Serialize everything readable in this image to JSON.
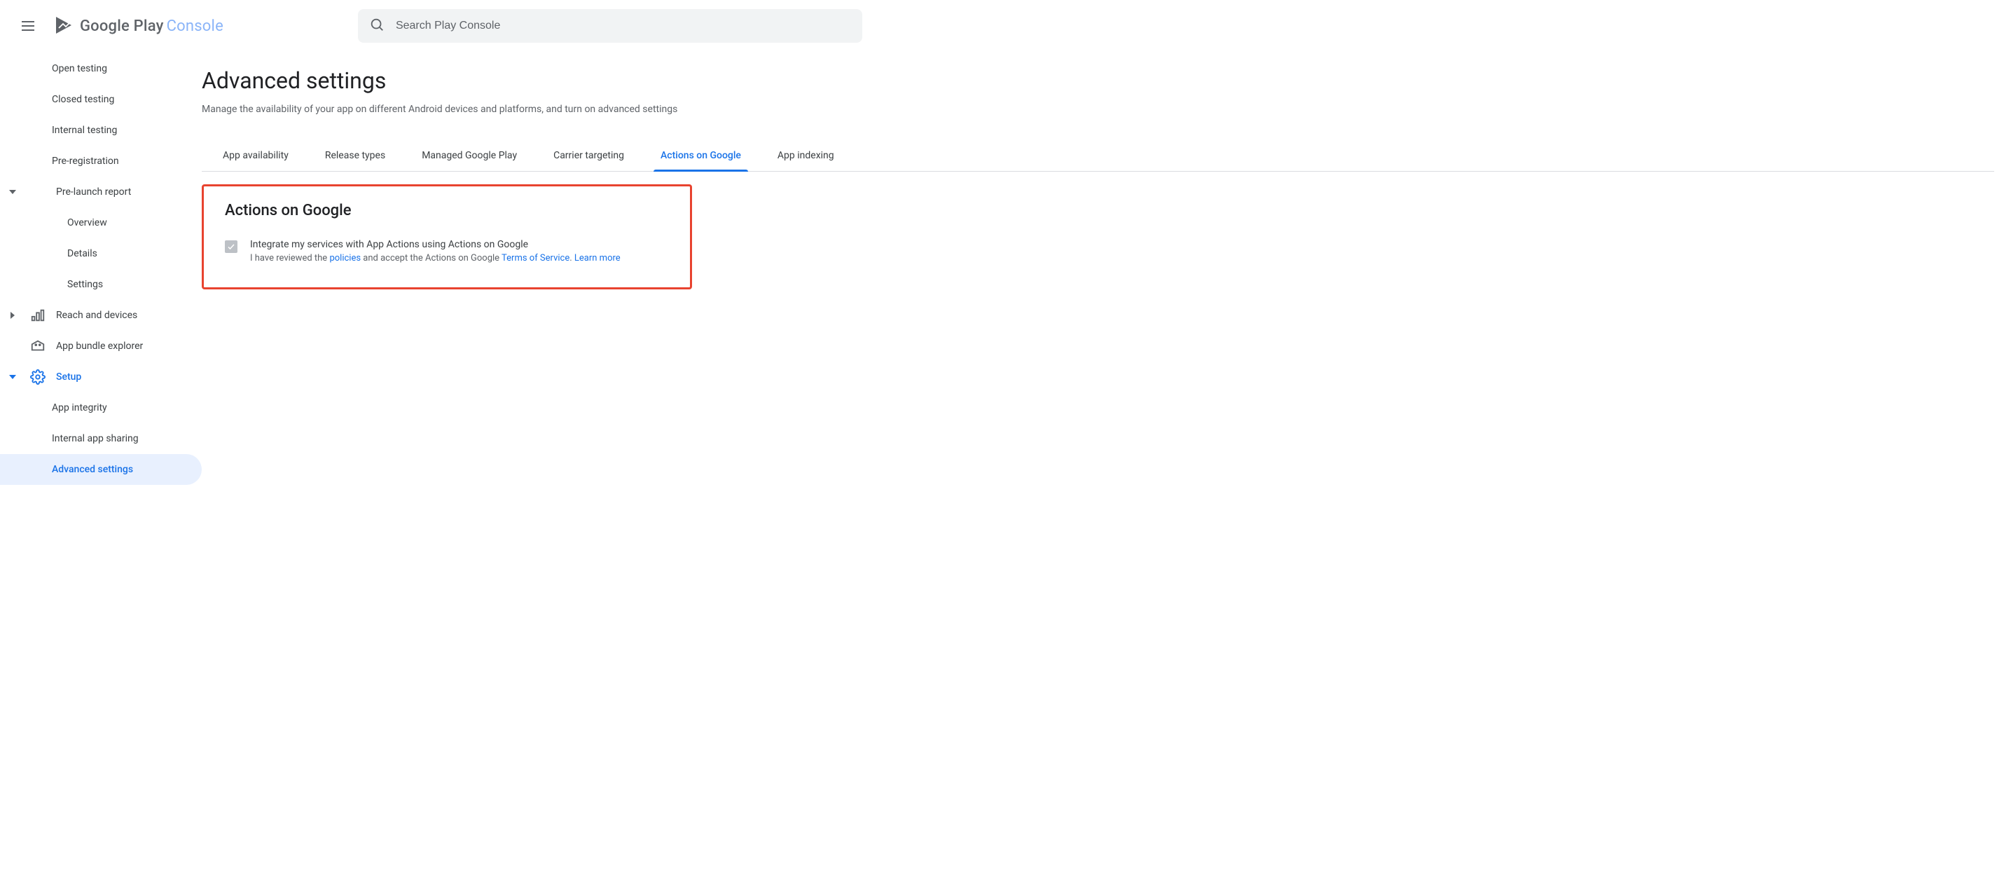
{
  "brand": {
    "product": "Google Play",
    "suffix": "Console"
  },
  "search": {
    "placeholder": "Search Play Console",
    "value": ""
  },
  "sidebar": {
    "items": [
      {
        "label": "Open testing"
      },
      {
        "label": "Closed testing"
      },
      {
        "label": "Internal testing"
      },
      {
        "label": "Pre-registration"
      },
      {
        "label": "Pre-launch report",
        "children": [
          {
            "label": "Overview"
          },
          {
            "label": "Details"
          },
          {
            "label": "Settings"
          }
        ]
      },
      {
        "label": "Reach and devices"
      },
      {
        "label": "App bundle explorer"
      },
      {
        "label": "Setup",
        "children": [
          {
            "label": "App integrity"
          },
          {
            "label": "Internal app sharing"
          },
          {
            "label": "Advanced settings"
          }
        ]
      }
    ]
  },
  "page": {
    "title": "Advanced settings",
    "subtitle": "Manage the availability of your app on different Android devices and platforms, and turn on advanced settings"
  },
  "tabs": [
    {
      "label": "App availability"
    },
    {
      "label": "Release types"
    },
    {
      "label": "Managed Google Play"
    },
    {
      "label": "Carrier targeting"
    },
    {
      "label": "Actions on Google"
    },
    {
      "label": "App indexing"
    }
  ],
  "panel": {
    "title": "Actions on Google",
    "checkbox_label": "Integrate my services with App Actions using Actions on Google",
    "sub_pre": "I have reviewed the ",
    "policies_link": "policies",
    "sub_mid": " and accept the Actions on Google ",
    "tos_link": "Terms of Service",
    "sub_sep": ". ",
    "learn_link": "Learn more"
  }
}
